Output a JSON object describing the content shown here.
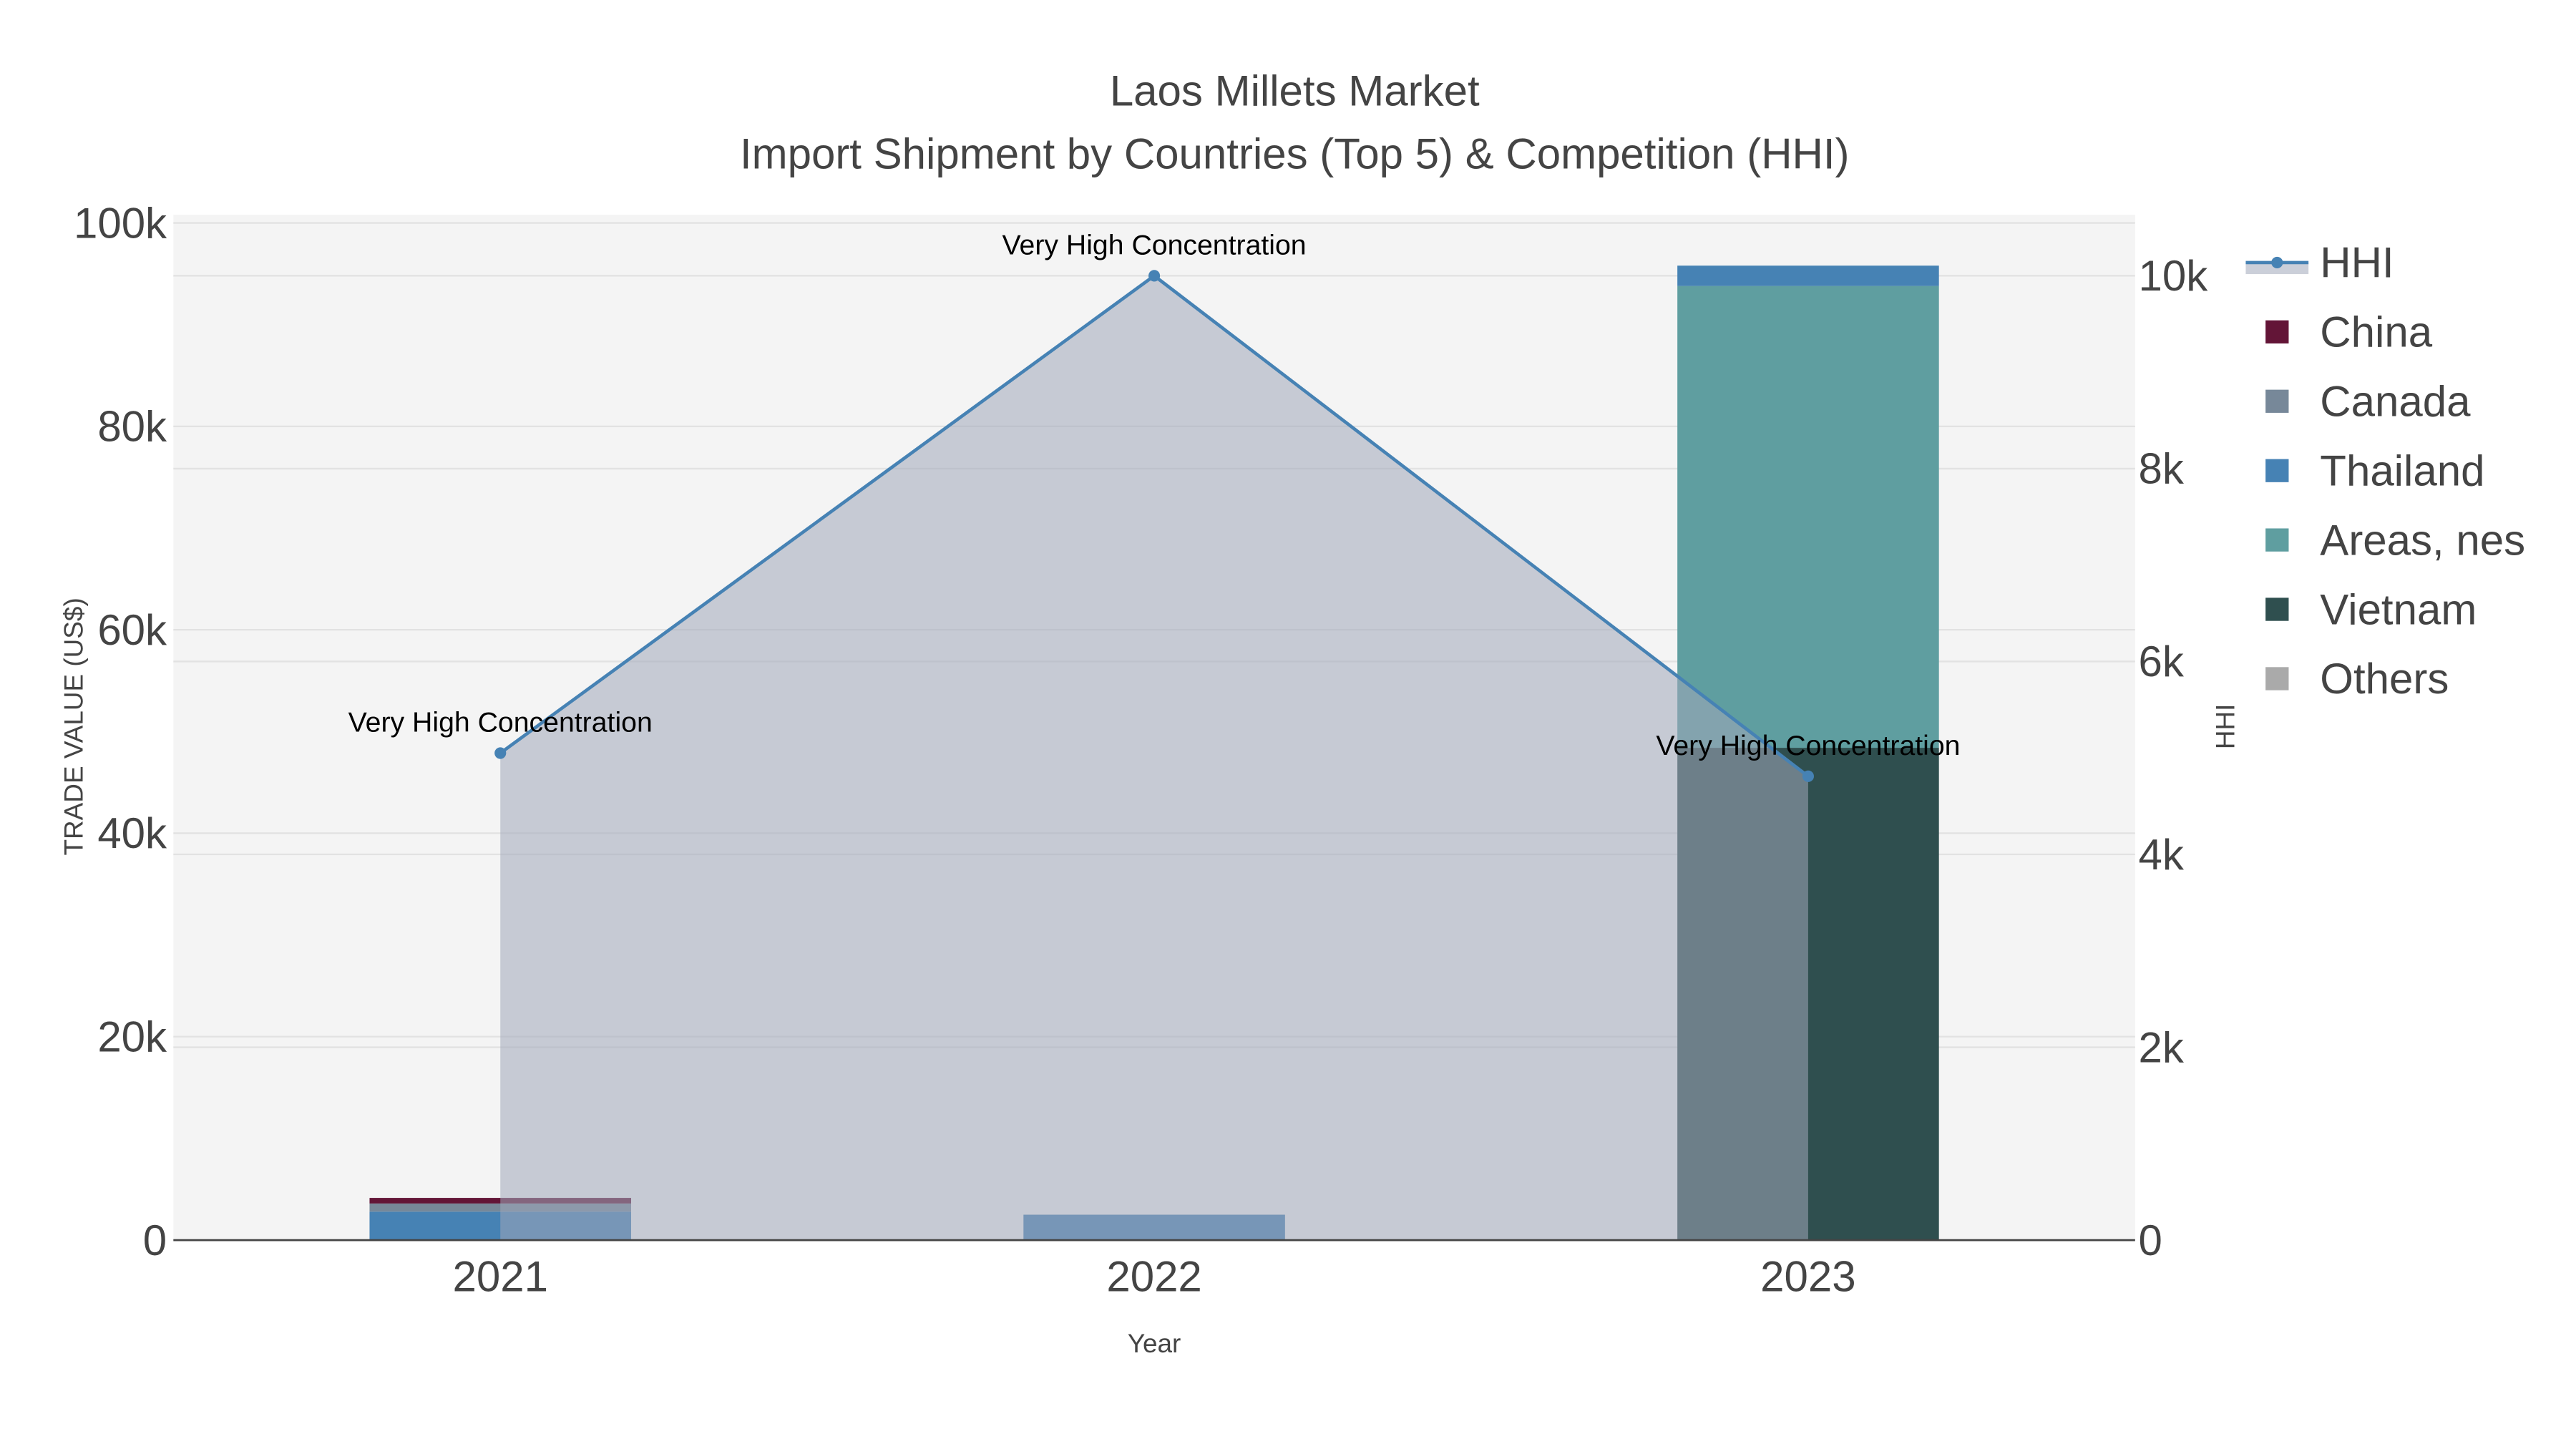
{
  "chart_data": {
    "type": "bar",
    "title": "Laos Millets Market",
    "subtitle": "Import Shipment by Countries (Top 5) & Competition (HHI)",
    "xlabel": "Year",
    "ylabel": "TRADE VALUE (US$)",
    "y2label": "HHI",
    "categories": [
      "2021",
      "2022",
      "2023"
    ],
    "ylim": [
      0,
      100000
    ],
    "y2lim": [
      0,
      10000
    ],
    "yticks": [
      "0",
      "20k",
      "40k",
      "60k",
      "80k",
      "100k"
    ],
    "y2ticks": [
      "0",
      "2k",
      "4k",
      "6k",
      "8k",
      "10k"
    ],
    "barmode": "stack",
    "series": [
      {
        "name": "Vietnam",
        "color": "#2f4f4f",
        "values": [
          0,
          0,
          48400
        ]
      },
      {
        "name": "Areas, nes",
        "color": "#5f9ea0",
        "values": [
          0,
          0,
          45400
        ]
      },
      {
        "name": "Thailand",
        "color": "#4682b4",
        "values": [
          2800,
          2500,
          2000
        ]
      },
      {
        "name": "Canada",
        "color": "#778899",
        "values": [
          800,
          0,
          0
        ]
      },
      {
        "name": "China",
        "color": "#631537",
        "values": [
          550,
          0,
          0
        ]
      },
      {
        "name": "Others",
        "color": "#aaaaaa",
        "values": [
          0,
          0,
          0
        ]
      }
    ],
    "hhi": {
      "name": "HHI",
      "color": "#4682b4",
      "fill": "rgba(160,168,185,0.55)",
      "values": [
        5050,
        10000,
        4810
      ],
      "annotations": [
        "Very High Concentration",
        "Very High Concentration",
        "Very High Concentration"
      ]
    },
    "legend_order": [
      "HHI",
      "China",
      "Canada",
      "Thailand",
      "Areas, nes",
      "Vietnam",
      "Others"
    ],
    "legend_position": "right",
    "grid": true
  }
}
